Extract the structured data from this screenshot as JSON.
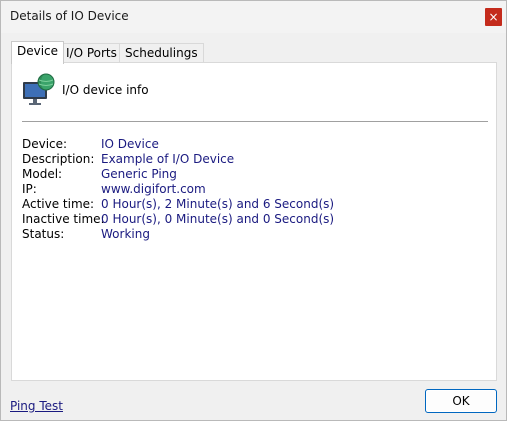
{
  "window": {
    "title": "Details of IO Device",
    "close_glyph": "×"
  },
  "tabs": [
    {
      "label": "Device",
      "active": true
    },
    {
      "label": "I/O Ports",
      "active": false
    },
    {
      "label": "Schedulings",
      "active": false
    }
  ],
  "panel": {
    "icon": "monitor-globe-icon",
    "heading": "I/O device info",
    "rows": [
      {
        "label": "Device:",
        "value": "IO Device"
      },
      {
        "label": "Description:",
        "value": "Example of I/O Device"
      },
      {
        "label": "Model:",
        "value": "Generic Ping"
      },
      {
        "label": "IP:",
        "value": "www.digifort.com"
      },
      {
        "label": "Active time:",
        "value": "0 Hour(s), 2 Minute(s) and 6 Second(s)"
      },
      {
        "label": "Inactive time:",
        "value": "0 Hour(s), 0 Minute(s) and 0 Second(s)"
      },
      {
        "label": "Status:",
        "value": "Working"
      }
    ]
  },
  "footer": {
    "ping_link": "Ping Test",
    "ok_label": "OK"
  },
  "colors": {
    "value_text": "#1a1a80",
    "close_button": "#c42b1c",
    "ok_border": "#0067c0"
  }
}
